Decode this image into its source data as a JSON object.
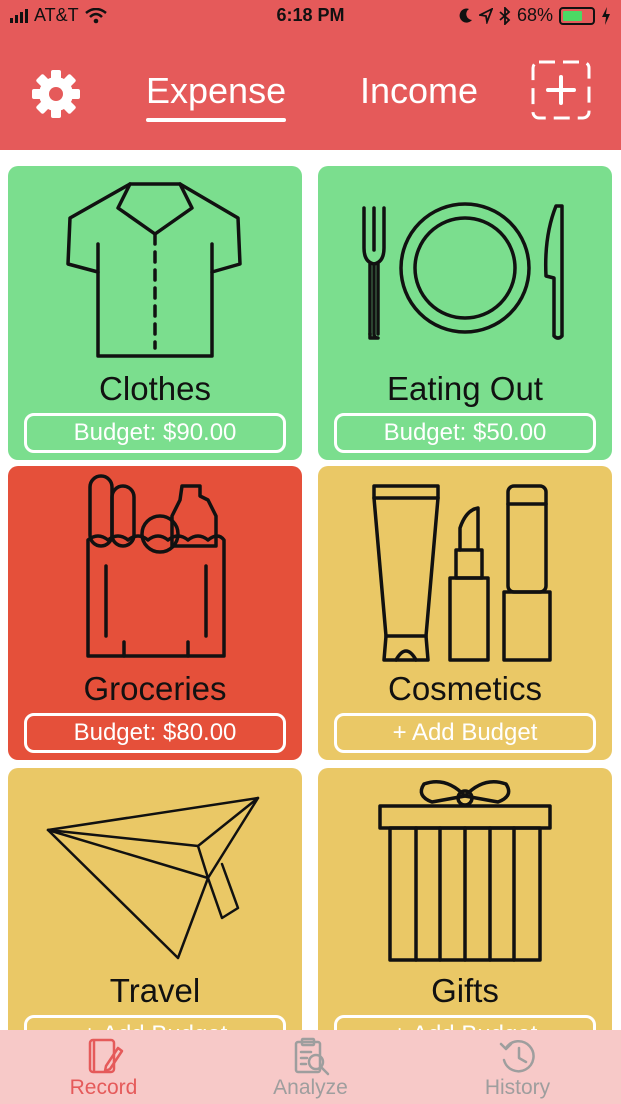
{
  "status": {
    "carrier": "AT&T",
    "time": "6:18 PM",
    "battery": "68%",
    "battery_level": 0.68
  },
  "header": {
    "tabs": [
      "Expense",
      "Income"
    ],
    "active_tab": "Expense"
  },
  "categories": [
    {
      "name": "Clothes",
      "budget": "Budget: $90.00",
      "color": "#7bde8e"
    },
    {
      "name": "Eating Out",
      "budget": "Budget: $50.00",
      "color": "#7bde8e"
    },
    {
      "name": "Groceries",
      "budget": "Budget: $80.00",
      "color": "#e5503a"
    },
    {
      "name": "Cosmetics",
      "budget": "+ Add Budget",
      "color": "#eac866"
    },
    {
      "name": "Travel",
      "budget": "+ Add Budget",
      "color": "#eac866"
    },
    {
      "name": "Gifts",
      "budget": "+ Add Budget",
      "color": "#eac866"
    }
  ],
  "tabbar": {
    "items": [
      {
        "label": "Record",
        "icon": "record-icon",
        "active": true
      },
      {
        "label": "Analyze",
        "icon": "analyze-icon",
        "active": false
      },
      {
        "label": "History",
        "icon": "history-icon",
        "active": false
      }
    ]
  },
  "colors": {
    "header": "#e55a5a",
    "tabbar": "#f7c9c8",
    "active": "#e55a5a",
    "inactive": "#9e9e9e"
  }
}
